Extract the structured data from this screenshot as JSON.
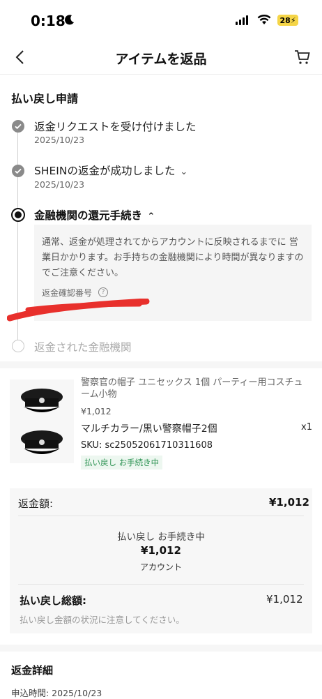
{
  "status_bar": {
    "time": "0:18",
    "battery": "28"
  },
  "header": {
    "title": "アイテムを返品"
  },
  "refund_request": {
    "section_title": "払い戻し申請",
    "steps": [
      {
        "title": "返金リクエストを受け付けました",
        "date": "2025/10/23"
      },
      {
        "title": "SHEINの返金が成功しました",
        "date": "2025/10/23",
        "chevron": "⌄"
      },
      {
        "title": "金融機関の還元手続き",
        "chevron": "⌃"
      },
      {
        "title": "返金された金融機関"
      }
    ],
    "info_text": "通常、返金が処理されてからアカウントに反映されるまでに 営業日かかります。お手持ちの金融機関により時間が異なりますのでご注意ください。",
    "confirm_label": "返金確認番号",
    "help_glyph": "?"
  },
  "product": {
    "title": "警察官の帽子 ユニセックス 1個 パーティー用コスチューム小物",
    "price": "¥1,012",
    "variant": "マルチカラー/黒い警察帽子2個",
    "qty": "x1",
    "sku": "SKU: sc25052061710311608",
    "status": "払い戻し お手続き中"
  },
  "refund_summary": {
    "amount_label": "返金額:",
    "amount_value": "¥1,012",
    "center_status": "払い戻し お手続き中",
    "center_amount": "¥1,012",
    "center_account": "アカウント",
    "total_label": "払い戻し総額:",
    "total_value": "¥1,012",
    "note": "払い戻し金額の状況に注意してください。"
  },
  "refund_details": {
    "title": "返金詳細",
    "applied_time": "申込時間:  2025/10/23"
  },
  "colors": {
    "accent_green": "#2f9455",
    "redaction": "#e8302c"
  }
}
